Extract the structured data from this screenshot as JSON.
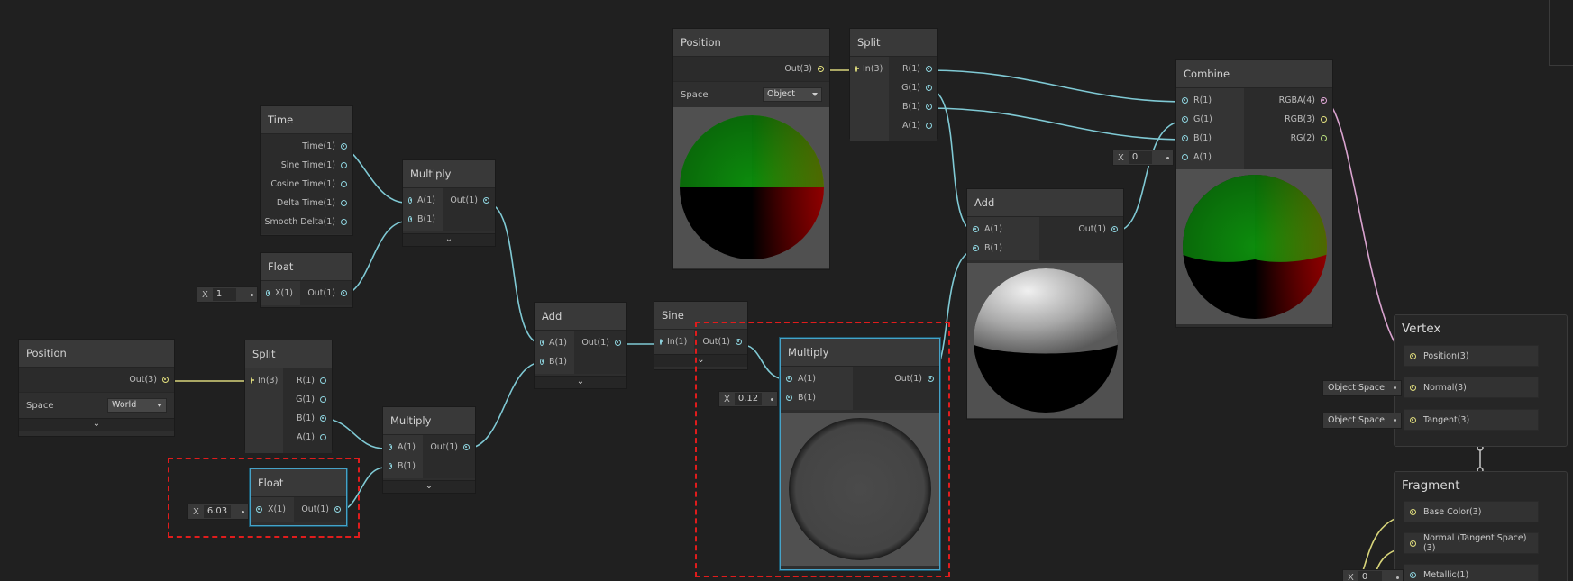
{
  "colors": {
    "cyan": "#8fd5e0",
    "yellow": "#e3e07e",
    "pink": "#e2a9d8",
    "selection": "#46a2c7",
    "highlight": "#e01c1c"
  },
  "icons": {
    "expand": "chevron-down-icon",
    "port": "port-dot-icon"
  },
  "time_node": {
    "title": "Time",
    "outputs": [
      "Time(1)",
      "Sine Time(1)",
      "Cosine Time(1)",
      "Delta Time(1)",
      "Smooth Delta(1)"
    ]
  },
  "float_top": {
    "title": "Float",
    "input": "X(1)",
    "output": "Out(1)",
    "x_label": "X",
    "x_value": "1"
  },
  "multiply_top": {
    "title": "Multiply",
    "inputs": [
      "A(1)",
      "B(1)"
    ],
    "output": "Out(1)"
  },
  "position_left": {
    "title": "Position",
    "output": "Out(3)",
    "space_label": "Space",
    "space_value": "World"
  },
  "split_left": {
    "title": "Split",
    "input": "In(3)",
    "outputs": [
      "R(1)",
      "G(1)",
      "B(1)",
      "A(1)"
    ]
  },
  "multiply_mid": {
    "title": "Multiply",
    "inputs": [
      "A(1)",
      "B(1)"
    ],
    "output": "Out(1)"
  },
  "float_bottom": {
    "title": "Float",
    "input": "X(1)",
    "output": "Out(1)",
    "x_label": "X",
    "x_value": "6.03"
  },
  "add_mid": {
    "title": "Add",
    "inputs": [
      "A(1)",
      "B(1)"
    ],
    "output": "Out(1)"
  },
  "sine": {
    "title": "Sine",
    "input": "In(1)",
    "output": "Out(1)"
  },
  "multiply_sel": {
    "title": "Multiply",
    "inputs": [
      "A(1)",
      "B(1)"
    ],
    "output": "Out(1)",
    "x_label": "X",
    "x_value": "0.12"
  },
  "position_top": {
    "title": "Position",
    "output": "Out(3)",
    "space_label": "Space",
    "space_value": "Object"
  },
  "split_top": {
    "title": "Split",
    "input": "In(3)",
    "outputs": [
      "R(1)",
      "G(1)",
      "B(1)",
      "A(1)"
    ]
  },
  "add_right": {
    "title": "Add",
    "inputs": [
      "A(1)",
      "B(1)"
    ],
    "output": "Out(1)"
  },
  "combine": {
    "title": "Combine",
    "inputs": [
      "R(1)",
      "G(1)",
      "B(1)",
      "A(1)"
    ],
    "outputs": [
      "RGBA(4)",
      "RGB(3)",
      "RG(2)"
    ],
    "x_label": "X",
    "x_value": "0"
  },
  "vertex": {
    "title": "Vertex",
    "slots": [
      "Position(3)",
      "Normal(3)",
      "Tangent(3)"
    ],
    "normal_space": "Object Space",
    "tangent_space": "Object Space"
  },
  "fragment": {
    "title": "Fragment",
    "slots": [
      "Base Color(3)",
      "Normal (Tangent Space)(3)",
      "Metallic(1)"
    ],
    "x_label": "X",
    "x_value": "0"
  }
}
